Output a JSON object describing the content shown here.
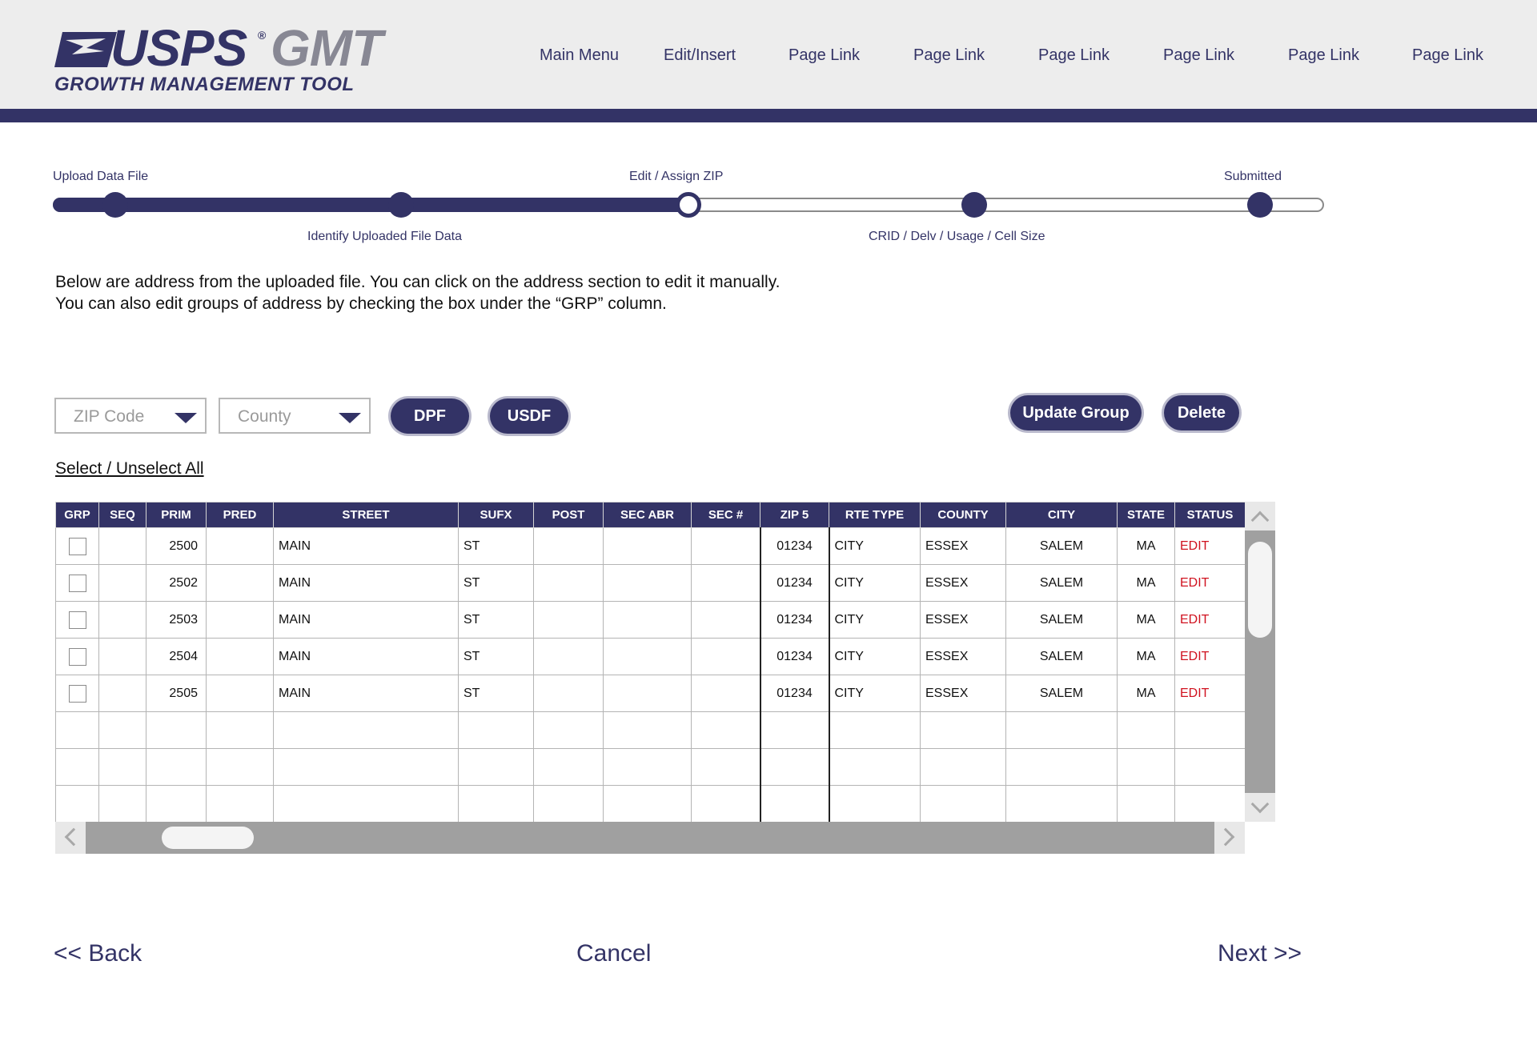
{
  "colors": {
    "brand": "#333366",
    "edit_status": "#d0121f",
    "header_bg": "#ededed",
    "scroll": "#a0a0a0"
  },
  "logo": {
    "primary": "USPS",
    "reg_mark": "®",
    "product": "GMT",
    "subtitle": "GROWTH MANAGEMENT TOOL",
    "icon": "eagle-icon"
  },
  "nav": [
    "Main Menu",
    "Edit/Insert",
    "Page Link",
    "Page Link",
    "Page Link",
    "Page Link",
    "Page Link",
    "Page Link"
  ],
  "progress": {
    "steps": [
      "Upload Data File",
      "Identify Uploaded File Data",
      "Edit / Assign ZIP",
      "CRID / Delv / Usage / Cell Size",
      "Submitted"
    ],
    "current_step": 3,
    "completed_fraction": 0.5
  },
  "intro": {
    "line1": "Below are address from the uploaded file. You can click on the address section to edit it manually.",
    "line2": "You can also edit groups of address by checking the box under the “GRP” column."
  },
  "filters": {
    "zip_placeholder": "ZIP Code",
    "county_placeholder": "County",
    "dpf": "DPF",
    "usdf": "USDF",
    "update_group": "Update Group",
    "delete": "Delete",
    "select_all": "Select / Unselect All"
  },
  "table": {
    "columns": [
      "GRP",
      "SEQ",
      "PRIM",
      "PRED",
      "STREET",
      "SUFX",
      "POST",
      "SEC ABR",
      "SEC #",
      "ZIP 5",
      "RTE TYPE",
      "COUNTY",
      "CITY",
      "STATE",
      "STATUS"
    ],
    "rows": [
      {
        "seq": "",
        "prim": "2500",
        "pred": "",
        "street": "MAIN",
        "sufx": "ST",
        "post": "",
        "sec_abr": "",
        "sec_num": "",
        "zip5": "01234",
        "rte_type": "CITY",
        "county": "ESSEX",
        "city": "SALEM",
        "state": "MA",
        "status": "EDIT"
      },
      {
        "seq": "",
        "prim": "2502",
        "pred": "",
        "street": "MAIN",
        "sufx": "ST",
        "post": "",
        "sec_abr": "",
        "sec_num": "",
        "zip5": "01234",
        "rte_type": "CITY",
        "county": "ESSEX",
        "city": "SALEM",
        "state": "MA",
        "status": "EDIT"
      },
      {
        "seq": "",
        "prim": "2503",
        "pred": "",
        "street": "MAIN",
        "sufx": "ST",
        "post": "",
        "sec_abr": "",
        "sec_num": "",
        "zip5": "01234",
        "rte_type": "CITY",
        "county": "ESSEX",
        "city": "SALEM",
        "state": "MA",
        "status": "EDIT"
      },
      {
        "seq": "",
        "prim": "2504",
        "pred": "",
        "street": "MAIN",
        "sufx": "ST",
        "post": "",
        "sec_abr": "",
        "sec_num": "",
        "zip5": "01234",
        "rte_type": "CITY",
        "county": "ESSEX",
        "city": "SALEM",
        "state": "MA",
        "status": "EDIT"
      },
      {
        "seq": "",
        "prim": "2505",
        "pred": "",
        "street": "MAIN",
        "sufx": "ST",
        "post": "",
        "sec_abr": "",
        "sec_num": "",
        "zip5": "01234",
        "rte_type": "CITY",
        "county": "ESSEX",
        "city": "SALEM",
        "state": "MA",
        "status": "EDIT"
      }
    ],
    "empty_rows": 3
  },
  "footer": {
    "back": "<< Back",
    "cancel": "Cancel",
    "next": "Next >>"
  }
}
